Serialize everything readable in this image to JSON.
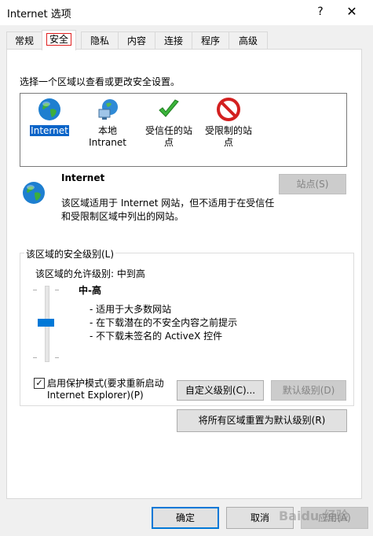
{
  "window": {
    "title": "Internet 选项",
    "help_label": "?",
    "close_label": "✕"
  },
  "tabs": [
    {
      "label": "常规"
    },
    {
      "label": "安全"
    },
    {
      "label": "隐私"
    },
    {
      "label": "内容"
    },
    {
      "label": "连接"
    },
    {
      "label": "程序"
    },
    {
      "label": "高级"
    }
  ],
  "security": {
    "zone_prompt": "选择一个区域以查看或更改安全设置。",
    "zones": [
      {
        "name_line1": "Internet",
        "name_line2": "",
        "icon": "globe-icon",
        "selected": true
      },
      {
        "name_line1": "本地",
        "name_line2": "Intranet",
        "icon": "intranet-icon",
        "selected": false
      },
      {
        "name_line1": "受信任的站",
        "name_line2": "点",
        "icon": "check-icon",
        "selected": false
      },
      {
        "name_line1": "受限制的站",
        "name_line2": "点",
        "icon": "restricted-icon",
        "selected": false
      }
    ],
    "zone_detail": {
      "title": "Internet",
      "desc_line1": "该区域适用于 Internet 网站，但不适用于在受信任",
      "desc_line2": "和受限制区域中列出的网站。",
      "sites_button": "站点(S)"
    },
    "level_group": {
      "title": "该区域的安全级别(L)",
      "allowed_levels": "该区域的允许级别: 中到高",
      "level_name": "中-高",
      "bullets": [
        "- 适用于大多数网站",
        "- 在下载潜在的不安全内容之前提示",
        "- 不下载未签名的 ActiveX 控件"
      ],
      "protected_mode_line1": "启用保护模式(要求重新启动",
      "protected_mode_line2": "Internet Explorer)(P)",
      "protected_mode_checked": true,
      "custom_level_button": "自定义级别(C)...",
      "default_level_button": "默认级别(D)"
    },
    "reset_all_button": "将所有区域重置为默认级别(R)"
  },
  "footer": {
    "ok_label": "确定",
    "cancel_label": "取消",
    "apply_label": "应用(A)"
  },
  "watermark": "Baidu 经验"
}
